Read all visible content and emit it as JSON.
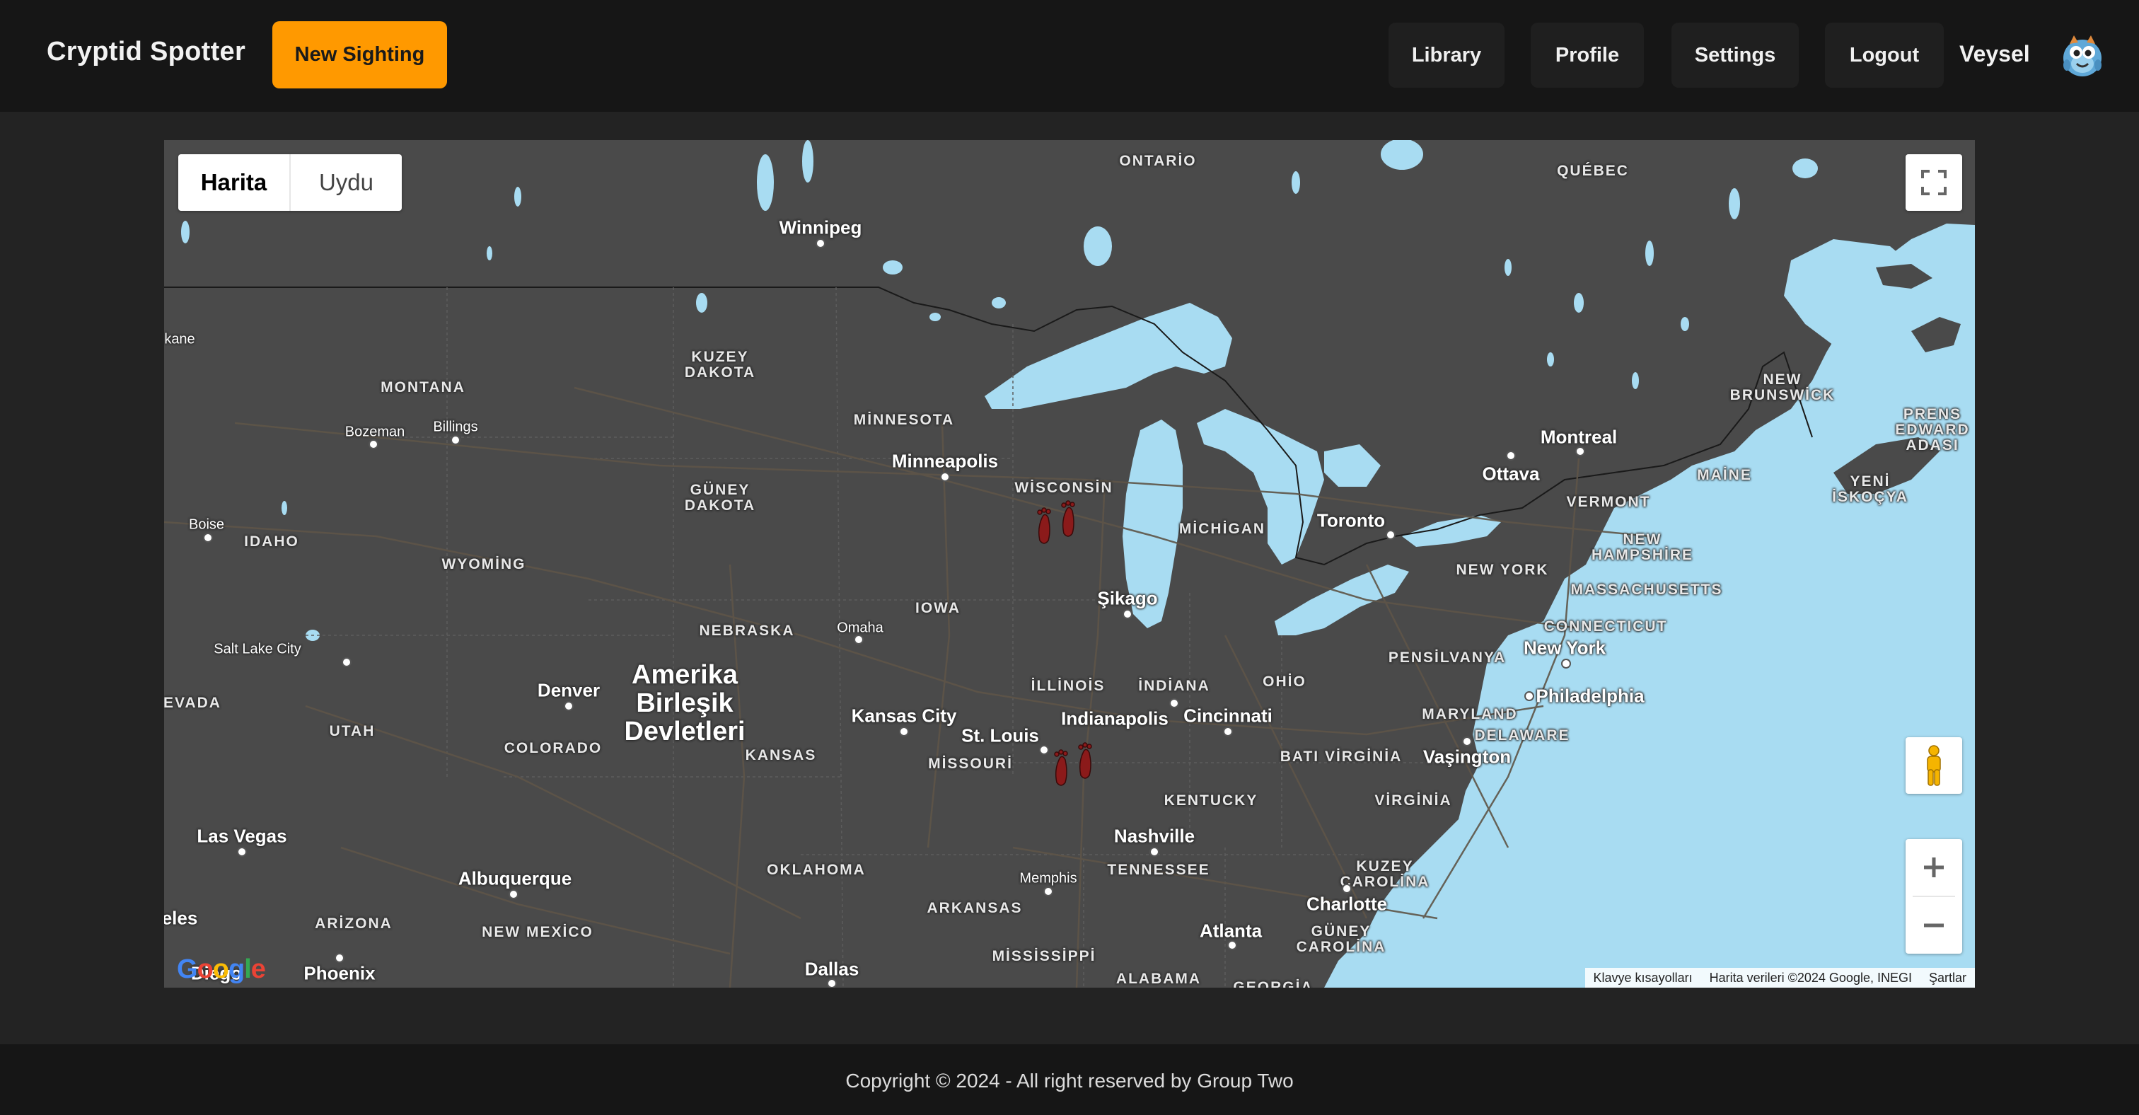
{
  "navbar": {
    "brand": "Cryptid Spotter",
    "new_sighting": "New Sighting",
    "library": "Library",
    "profile": "Profile",
    "settings": "Settings",
    "logout": "Logout",
    "username": "Veysel",
    "accent_color": "#ff9900"
  },
  "map": {
    "type_map": "Harita",
    "type_satellite": "Uydu",
    "attribution": {
      "shortcuts": "Klavye kısayolları",
      "data": "Harita verileri ©2024 Google, INEGI",
      "terms": "Şartlar"
    },
    "google_logo": "Google",
    "labels": {
      "ontario": "ONTARİO",
      "quebec": "QUÉBEC",
      "winnipeg": "Winnipeg",
      "spokane": "kane",
      "kuzey_dakota": "KUZEY\nDAKOTA",
      "montana": "MONTANA",
      "bozeman": "Bozeman",
      "billings": "Billings",
      "minnesota": "MİNNESOTA",
      "minneapolis": "Minneapolis",
      "wisconsin": "WİSCONSİN",
      "guney_dakota": "GÜNEY\nDAKOTA",
      "boise": "Boise",
      "idaho": "IDAHO",
      "wyoming": "WYOMİNG",
      "michigan": "MİCHİGAN",
      "toronto": "Toronto",
      "ottava": "Ottava",
      "montreal": "Montreal",
      "new_brunswick": "NEW\nBRUNSWİCK",
      "prens_edward": "PRENS\nEDWARD\nADASI",
      "maine": "MAİNE",
      "vermont": "VERMONT",
      "yeni_iskocya": "YENİ\nİSKOÇYA",
      "new_hampshire": "NEW\nHAMPSHİRE",
      "new_york_state": "NEW YORK",
      "massachusetts": "MASSACHUSETTS",
      "connecticut": "CONNECTICUT",
      "new_york": "New York",
      "iowa": "IOWA",
      "sikago": "Şikago",
      "nebraska": "NEBRASKA",
      "omaha": "Omaha",
      "salt_lake": "Salt Lake City",
      "nevada": "EVADA",
      "utah": "UTAH",
      "denver": "Denver",
      "colorado": "COLORADO",
      "country": "Amerika\nBirleşik\nDevletleri",
      "kansas": "KANSAS",
      "kansas_city": "Kansas City",
      "missouri": "MİSSOURİ",
      "st_louis": "St. Louis",
      "illinois": "İLLİNOİS",
      "indiana": "İNDİANA",
      "ohio": "OHİO",
      "indianapolis": "Indianapolis",
      "cincinnati": "Cincinnati",
      "pensilvanya": "PENSİLVANYA",
      "philadelphia": "Philadelphia",
      "maryland": "MARYLAND",
      "delaware": "DELAWARE",
      "vasington": "Vaşington",
      "bati_virginia": "BATI VİRGİNİA",
      "virginia": "VİRGİNİA",
      "kentucky": "KENTUCKY",
      "las_vegas": "Las Vegas",
      "nashville": "Nashville",
      "tennessee": "TENNESSEE",
      "oklahoma": "OKLAHOMA",
      "memphis": "Memphis",
      "albuquerque": "Albuquerque",
      "arkansas": "ARKANSAS",
      "kuzey_carolina": "KUZEY\nCAROLİNA",
      "charlotte": "Charlotte",
      "angeles": "eles",
      "arizona": "ARİZONA",
      "new_mexico": "NEW MEXİCO",
      "atlanta": "Atlanta",
      "guney_carolina": "GÜNEY\nCAROLİNA",
      "phoenix": "Phoenix",
      "san_diego": "Diego",
      "dallas": "Dallas",
      "mississippi": "MİSSİSSİPPİ",
      "alabama": "ALABAMA",
      "georgia": "GEORGİA"
    }
  },
  "footer": {
    "text": "Copyright © 2024 - All right reserved by Group Two"
  }
}
